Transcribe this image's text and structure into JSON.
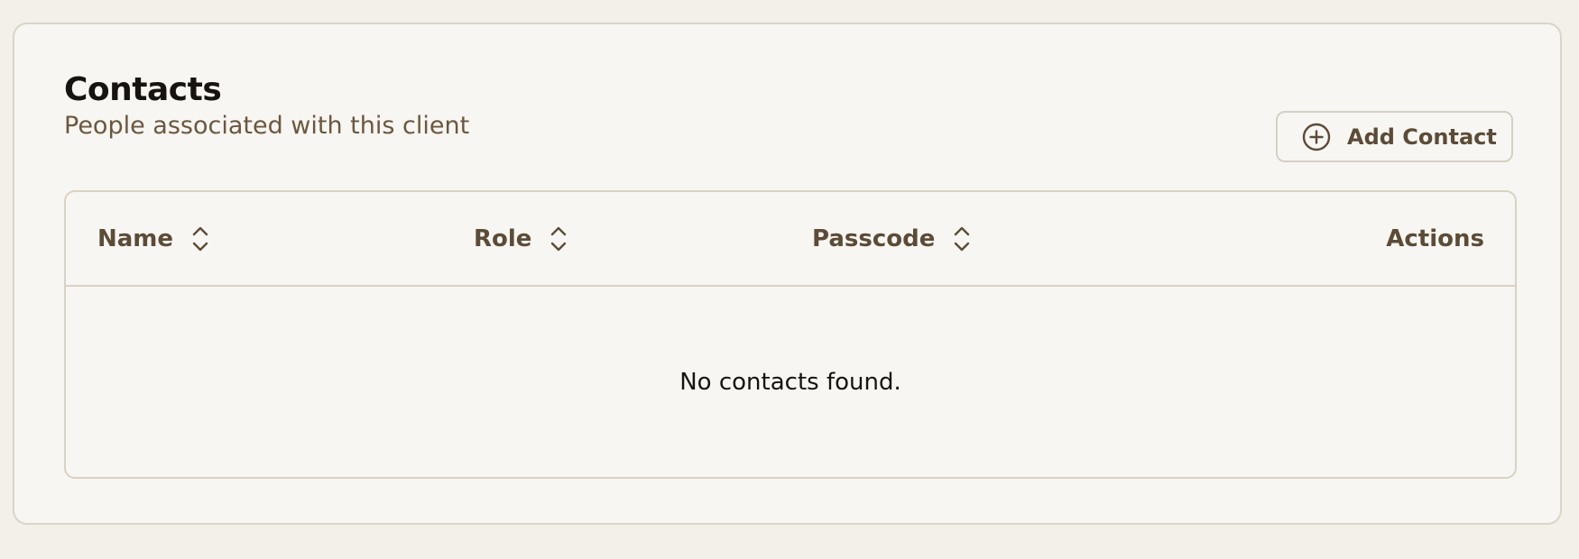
{
  "section": {
    "title": "Contacts",
    "subtitle": "People associated with this client",
    "add_button_label": "Add Contact"
  },
  "table": {
    "columns": [
      {
        "label": "Name",
        "sortable": true
      },
      {
        "label": "Role",
        "sortable": true
      },
      {
        "label": "Passcode",
        "sortable": true
      },
      {
        "label": "Actions",
        "sortable": false
      }
    ],
    "rows": [],
    "empty_message": "No contacts found."
  },
  "icons": {
    "add": "plus-circle-icon",
    "sort": "chevron-up-down-icon"
  },
  "colors": {
    "background": "#f3efe9",
    "card": "#f8f6f2",
    "border": "#d9d1c4",
    "text_primary": "#17130e",
    "text_secondary": "#5c4b37"
  }
}
